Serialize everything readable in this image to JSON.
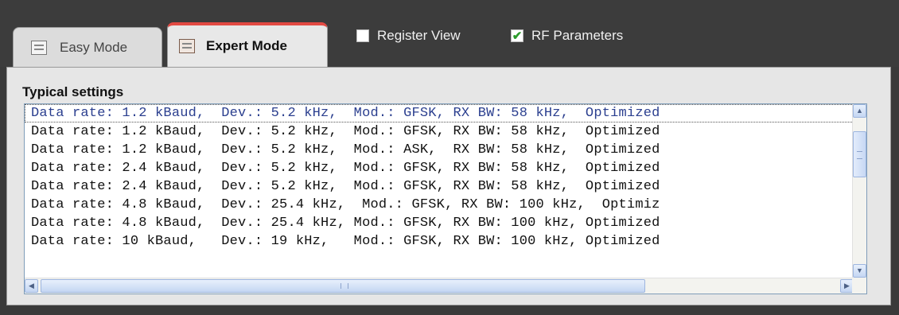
{
  "tabs": {
    "easy_label": "Easy Mode",
    "expert_label": "Expert Mode"
  },
  "options": {
    "register_view_label": "Register View",
    "register_view_checked": false,
    "rf_parameters_label": "RF Parameters",
    "rf_parameters_checked": true
  },
  "typical_settings": {
    "title": "Typical settings",
    "rows": [
      "Data rate: 1.2 kBaud,  Dev.: 5.2 kHz,  Mod.: GFSK, RX BW: 58 kHz,  Optimized",
      "Data rate: 1.2 kBaud,  Dev.: 5.2 kHz,  Mod.: GFSK, RX BW: 58 kHz,  Optimized",
      "Data rate: 1.2 kBaud,  Dev.: 5.2 kHz,  Mod.: ASK,  RX BW: 58 kHz,  Optimized",
      "Data rate: 2.4 kBaud,  Dev.: 5.2 kHz,  Mod.: GFSK, RX BW: 58 kHz,  Optimized",
      "Data rate: 2.4 kBaud,  Dev.: 5.2 kHz,  Mod.: GFSK, RX BW: 58 kHz,  Optimized",
      "Data rate: 4.8 kBaud,  Dev.: 25.4 kHz,  Mod.: GFSK, RX BW: 100 kHz,  Optimiz",
      "Data rate: 4.8 kBaud,  Dev.: 25.4 kHz, Mod.: GFSK, RX BW: 100 kHz, Optimized",
      "Data rate: 10 kBaud,   Dev.: 19 kHz,   Mod.: GFSK, RX BW: 100 kHz, Optimized"
    ],
    "selected_index": 0
  },
  "icons": {
    "scroll_up": "▲",
    "scroll_down": "▼",
    "scroll_left": "◀",
    "scroll_right": "▶",
    "check": "✔"
  },
  "colors": {
    "active_tab_accent": "#e24a43",
    "check_mark": "#2a9a2a",
    "selected_text": "#2b3f8f"
  }
}
